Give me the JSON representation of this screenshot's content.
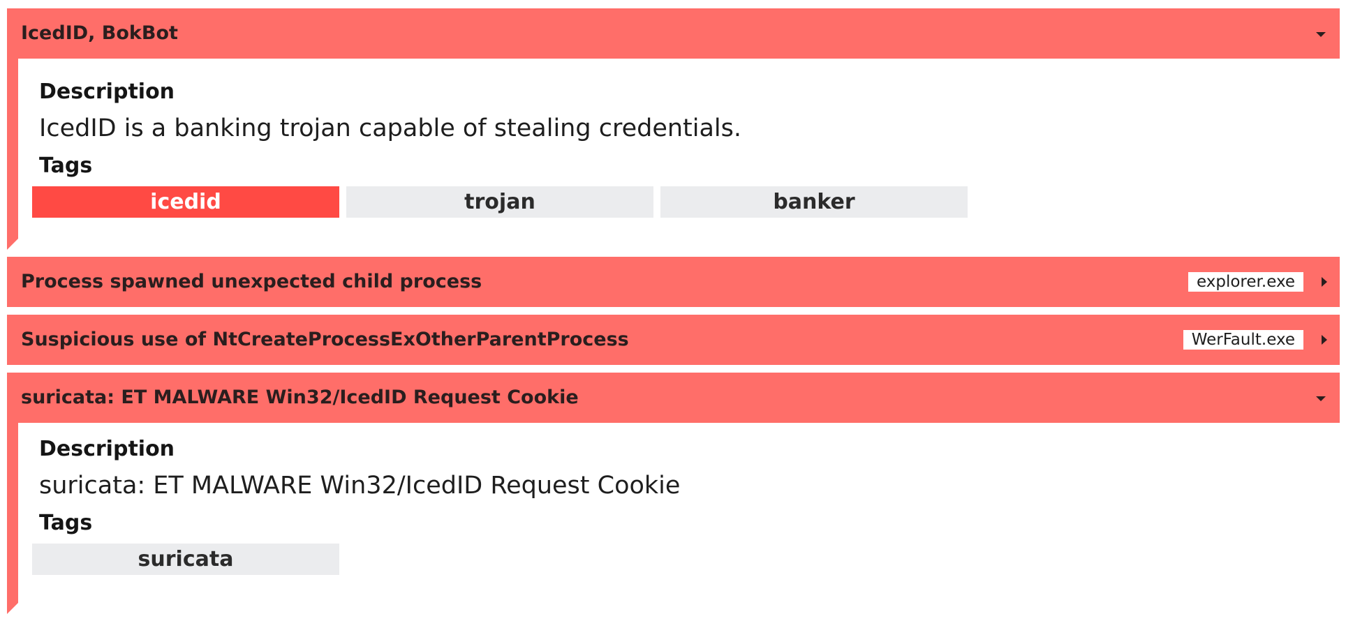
{
  "signatures": [
    {
      "title": "IcedID, BokBot",
      "expanded": true,
      "description_label": "Description",
      "description": "IcedID is a banking trojan capable of stealing credentials.",
      "tags_label": "Tags",
      "tags": [
        "icedid",
        "trojan",
        "banker"
      ],
      "highlighted_tag": "icedid"
    },
    {
      "title": "Process spawned unexpected child process",
      "expanded": false,
      "process": "explorer.exe"
    },
    {
      "title": "Suspicious use of NtCreateProcessExOtherParentProcess",
      "expanded": false,
      "process": "WerFault.exe"
    },
    {
      "title": "suricata: ET MALWARE Win32/IcedID Request Cookie",
      "expanded": true,
      "description_label": "Description",
      "description": "suricata: ET MALWARE Win32/IcedID Request Cookie",
      "tags_label": "Tags",
      "tags": [
        "suricata"
      ]
    }
  ],
  "colors": {
    "header_bg": "#ff6e69",
    "primary_tag_bg": "#ff4a44",
    "tag_bg": "#ebecee"
  },
  "icons": {
    "expanded": "chevron-down-icon",
    "collapsed": "chevron-right-icon"
  }
}
